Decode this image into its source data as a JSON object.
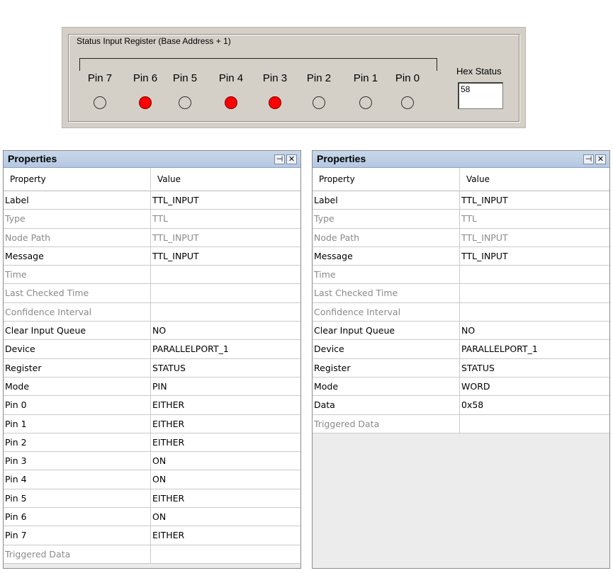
{
  "status_register": {
    "title": "Status Input Register (Base Address + 1)",
    "pins": [
      {
        "label": "Pin 7",
        "on": false
      },
      {
        "label": "Pin 6",
        "on": true
      },
      {
        "label": "Pin 5",
        "on": false
      },
      {
        "label": "Pin 4",
        "on": true
      },
      {
        "label": "Pin 3",
        "on": true
      },
      {
        "label": "Pin 2",
        "on": false
      },
      {
        "label": "Pin 1",
        "on": false
      },
      {
        "label": "Pin 0",
        "on": false
      }
    ],
    "hex_label": "Hex Status",
    "hex_value": "58",
    "colors": {
      "led_on": "#ff0000",
      "led_off": "#d4d0c8",
      "panel": "#d4d0c8"
    }
  },
  "left_panel": {
    "title": "Properties",
    "pin_icon": "pin-icon",
    "close_icon": "close-icon",
    "headers": {
      "property": "Property",
      "value": "Value"
    },
    "rows": [
      {
        "property": "Label",
        "value": "TTL_INPUT",
        "dim": false
      },
      {
        "property": "Type",
        "value": "TTL",
        "dim": true
      },
      {
        "property": "Node Path",
        "value": "TTL_INPUT",
        "dim": true
      },
      {
        "property": "Message",
        "value": "TTL_INPUT",
        "dim": false
      },
      {
        "property": "Time",
        "value": "",
        "dim": true
      },
      {
        "property": "Last Checked Time",
        "value": "",
        "dim": true
      },
      {
        "property": "Confidence Interval",
        "value": "",
        "dim": true
      },
      {
        "property": "Clear Input Queue",
        "value": "NO",
        "dim": false
      },
      {
        "property": "Device",
        "value": "PARALLELPORT_1",
        "dim": false
      },
      {
        "property": "Register",
        "value": "STATUS",
        "dim": false
      },
      {
        "property": "Mode",
        "value": "PIN",
        "dim": false
      },
      {
        "property": "Pin 0",
        "value": "EITHER",
        "dim": false
      },
      {
        "property": "Pin 1",
        "value": "EITHER",
        "dim": false
      },
      {
        "property": "Pin 2",
        "value": "EITHER",
        "dim": false
      },
      {
        "property": "Pin 3",
        "value": "ON",
        "dim": false
      },
      {
        "property": "Pin 4",
        "value": "ON",
        "dim": false
      },
      {
        "property": "Pin 5",
        "value": "EITHER",
        "dim": false
      },
      {
        "property": "Pin 6",
        "value": "ON",
        "dim": false
      },
      {
        "property": "Pin 7",
        "value": "EITHER",
        "dim": false
      },
      {
        "property": "Triggered Data",
        "value": "",
        "dim": true
      }
    ]
  },
  "right_panel": {
    "title": "Properties",
    "pin_icon": "pin-icon",
    "close_icon": "close-icon",
    "headers": {
      "property": "Property",
      "value": "Value"
    },
    "rows": [
      {
        "property": "Label",
        "value": "TTL_INPUT",
        "dim": false
      },
      {
        "property": "Type",
        "value": "TTL",
        "dim": true
      },
      {
        "property": "Node Path",
        "value": "TTL_INPUT",
        "dim": true
      },
      {
        "property": "Message",
        "value": "TTL_INPUT",
        "dim": false
      },
      {
        "property": "Time",
        "value": "",
        "dim": true
      },
      {
        "property": "Last Checked Time",
        "value": "",
        "dim": true
      },
      {
        "property": "Confidence Interval",
        "value": "",
        "dim": true
      },
      {
        "property": "Clear Input Queue",
        "value": "NO",
        "dim": false
      },
      {
        "property": "Device",
        "value": "PARALLELPORT_1",
        "dim": false
      },
      {
        "property": "Register",
        "value": "STATUS",
        "dim": false
      },
      {
        "property": "Mode",
        "value": "WORD",
        "dim": false
      },
      {
        "property": "Data",
        "value": "0x58",
        "dim": false
      },
      {
        "property": "Triggered Data",
        "value": "",
        "dim": true
      }
    ]
  }
}
